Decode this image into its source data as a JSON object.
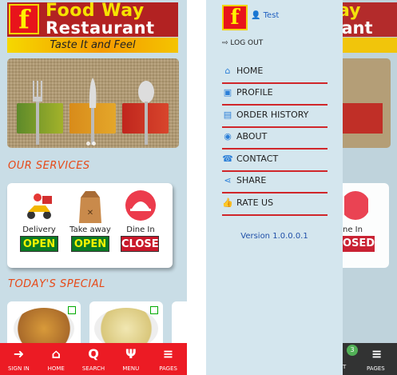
{
  "brand": {
    "logo_letter": "f",
    "name_line1": "Food Way",
    "name_line2": "Restaurant",
    "tagline": "Taste It and Feel"
  },
  "sections": {
    "services_title": "OUR SERVICES",
    "special_title": "TODAY'S SPECIAL"
  },
  "services": [
    {
      "label": "Delivery",
      "status": "OPEN"
    },
    {
      "label": "Take away",
      "status": "OPEN"
    },
    {
      "label": "Dine In",
      "status": "CLOSED"
    }
  ],
  "bottom_nav": [
    {
      "label": "SIGN IN",
      "icon": "sign-in-icon"
    },
    {
      "label": "HOME",
      "icon": "home-icon"
    },
    {
      "label": "SEARCH",
      "icon": "search-icon"
    },
    {
      "label": "MENU",
      "icon": "menu-icon"
    },
    {
      "label": "PAGES",
      "icon": "pages-icon"
    }
  ],
  "drawer": {
    "user": "Test",
    "logout": "LOG OUT",
    "items": [
      {
        "label": "HOME",
        "icon": "home-icon"
      },
      {
        "label": "PROFILE",
        "icon": "profile-icon"
      },
      {
        "label": "ORDER HISTORY",
        "icon": "book-icon"
      },
      {
        "label": "ABOUT",
        "icon": "about-icon"
      },
      {
        "label": "CONTACT",
        "icon": "phone-icon"
      },
      {
        "label": "SHARE",
        "icon": "share-icon"
      },
      {
        "label": "RATE US",
        "icon": "thumbs-up-icon"
      }
    ],
    "version": "Version 1.0.0.0.1"
  },
  "background_peek": {
    "dine_label": "ne In",
    "closed_badge": "OSED",
    "cart_count": "3",
    "nav_label_left": "T",
    "nav_label_pages": "PAGES"
  }
}
